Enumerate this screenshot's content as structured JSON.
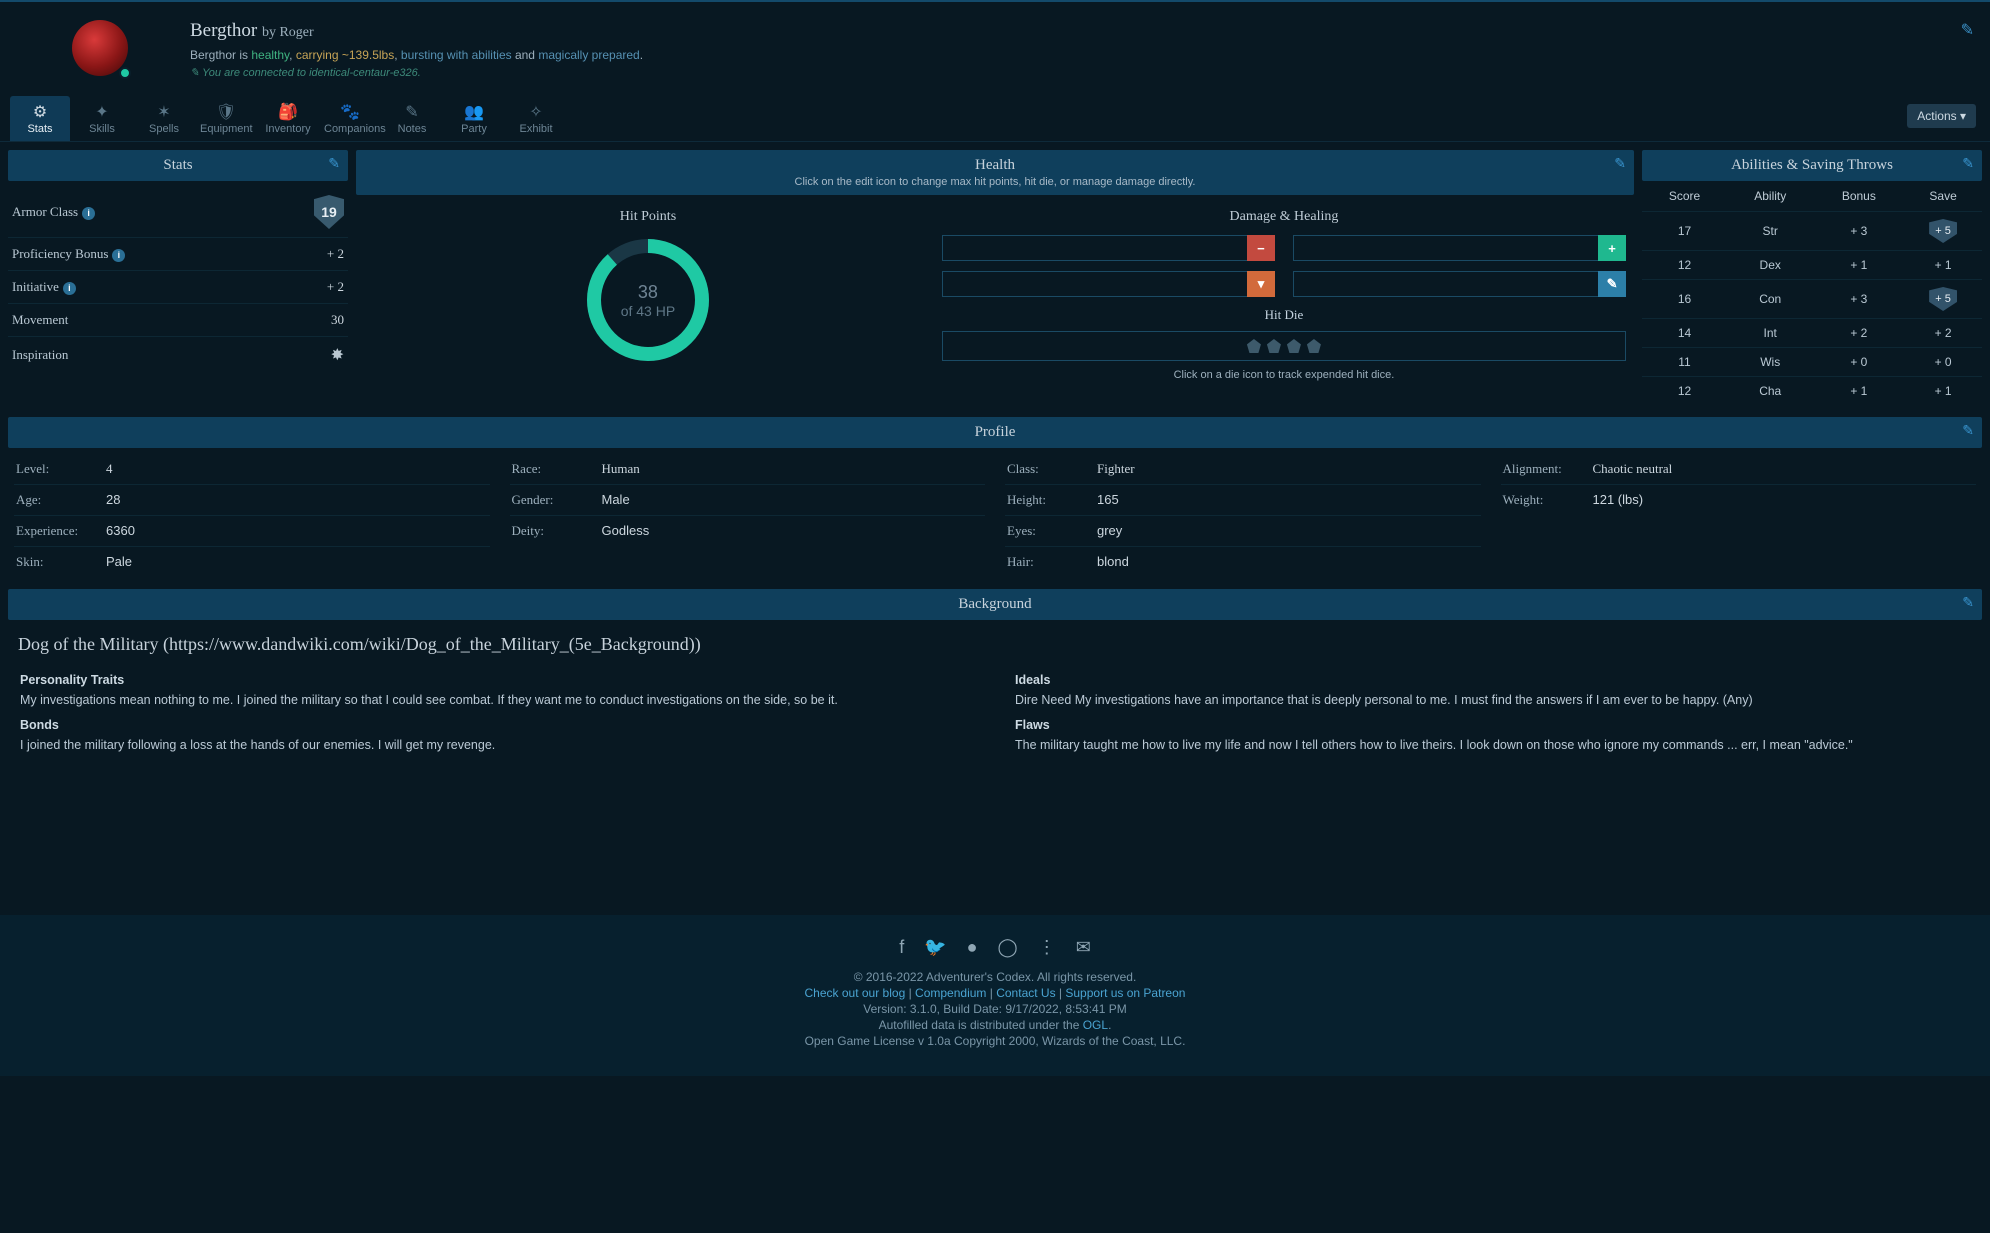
{
  "header": {
    "name": "Bergthor",
    "author_prefix": "by ",
    "author": "Roger",
    "status_prefix": "Bergthor is ",
    "status_healthy": "healthy",
    "status_sep1": ",  ",
    "status_carrying": "carrying ~139.5lbs",
    "status_sep2": ",  ",
    "status_bursting": "bursting with abilities",
    "status_and": " and ",
    "status_prepared": "magically prepared",
    "status_end": ".",
    "connect": "You are connected to identical-centaur-e326."
  },
  "tabs": [
    {
      "label": "Stats",
      "icon": "⚙"
    },
    {
      "label": "Skills",
      "icon": "✦"
    },
    {
      "label": "Spells",
      "icon": "✶"
    },
    {
      "label": "Equipment",
      "icon": "🛡"
    },
    {
      "label": "Inventory",
      "icon": "🎒"
    },
    {
      "label": "Companions",
      "icon": "🐾"
    },
    {
      "label": "Notes",
      "icon": "✎"
    },
    {
      "label": "Party",
      "icon": "👥"
    },
    {
      "label": "Exhibit",
      "icon": "✧"
    }
  ],
  "actions_label": "Actions ▾",
  "panels": {
    "stats_title": "Stats",
    "health_title": "Health",
    "health_sub": "Click on the edit icon to change max hit points, hit die, or manage damage directly.",
    "abilities_title": "Abilities & Saving Throws",
    "profile_title": "Profile",
    "background_title": "Background"
  },
  "stats": {
    "ac_label": "Armor Class",
    "ac_value": "19",
    "prof_label": "Proficiency Bonus",
    "prof_value": "+ 2",
    "init_label": "Initiative",
    "init_value": "+ 2",
    "move_label": "Movement",
    "move_value": "30",
    "insp_label": "Inspiration"
  },
  "health": {
    "hp_title": "Hit Points",
    "hp_current": "38",
    "hp_max_line": "of 43 HP",
    "dh_title": "Damage & Healing",
    "hitdie_title": "Hit Die",
    "hitdie_help": "Click on a die icon to track expended hit dice."
  },
  "abilities": {
    "headers": {
      "score": "Score",
      "ability": "Ability",
      "bonus": "Bonus",
      "save": "Save"
    },
    "rows": [
      {
        "score": "17",
        "ability": "Str",
        "bonus": "+ 3",
        "save": "+ 5",
        "shield": true
      },
      {
        "score": "12",
        "ability": "Dex",
        "bonus": "+ 1",
        "save": "+ 1",
        "shield": false
      },
      {
        "score": "16",
        "ability": "Con",
        "bonus": "+ 3",
        "save": "+ 5",
        "shield": true
      },
      {
        "score": "14",
        "ability": "Int",
        "bonus": "+ 2",
        "save": "+ 2",
        "shield": false
      },
      {
        "score": "11",
        "ability": "Wis",
        "bonus": "+ 0",
        "save": "+ 0",
        "shield": false
      },
      {
        "score": "12",
        "ability": "Cha",
        "bonus": "+ 1",
        "save": "+ 1",
        "shield": false
      }
    ]
  },
  "profile": {
    "col1": [
      {
        "label": "Level:",
        "value": "4",
        "serif": true
      },
      {
        "label": "Age:",
        "value": "28"
      },
      {
        "label": "Experience:",
        "value": "6360"
      },
      {
        "label": "Skin:",
        "value": "Pale"
      }
    ],
    "col2": [
      {
        "label": "Race:",
        "value": "Human",
        "serif": true
      },
      {
        "label": "Gender:",
        "value": "Male"
      },
      {
        "label": "Deity:",
        "value": "Godless"
      }
    ],
    "col3": [
      {
        "label": "Class:",
        "value": "Fighter",
        "serif": true
      },
      {
        "label": "Height:",
        "value": "165"
      },
      {
        "label": "Eyes:",
        "value": "grey"
      },
      {
        "label": "Hair:",
        "value": "blond"
      }
    ],
    "col4": [
      {
        "label": "Alignment:",
        "value": "Chaotic neutral",
        "serif": true
      },
      {
        "label": "Weight:",
        "value": "121 (lbs)"
      }
    ]
  },
  "background": {
    "title": "Dog of the Military (https://www.dandwiki.com/wiki/Dog_of_the_Military_(5e_Background))",
    "left": [
      {
        "h": "Personality Traits",
        "p": "My investigations mean nothing to me. I joined the military so that I could see combat. If they want me to conduct investigations on the side, so be it."
      },
      {
        "h": "Bonds",
        "p": "I joined the military following a loss at the hands of our enemies. I will get my revenge."
      }
    ],
    "right": [
      {
        "h": "Ideals",
        "p": "Dire Need My investigations have an importance that is deeply personal to me. I must find the answers if I am ever to be happy. (Any)"
      },
      {
        "h": "Flaws",
        "p": "The military taught me how to live my life and now I tell others how to live theirs. I look down on those who ignore my commands ... err, I mean \"advice.\""
      }
    ]
  },
  "footer": {
    "copyright": "© 2016-2022 Adventurer's Codex. All rights reserved.",
    "links": {
      "blog": "Check out our blog",
      "compendium": "Compendium",
      "contact": "Contact Us",
      "patreon": "Support us on Patreon"
    },
    "version": "Version: 3.1.0, Build Date: 9/17/2022, 8:53:41 PM",
    "autofill_pre": "Autofilled data is distributed under the ",
    "autofill_link": "OGL",
    "autofill_post": ".",
    "ogl": "Open Game License v 1.0a Copyright 2000, Wizards of the Coast, LLC."
  }
}
